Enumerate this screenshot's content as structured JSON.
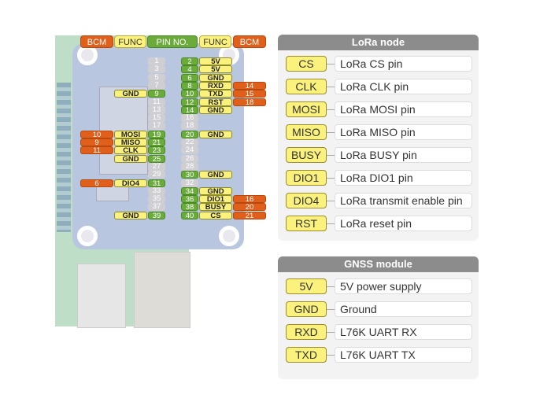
{
  "header": {
    "bcm_left": "BCM",
    "func_left": "FUNC",
    "pin_no": "PIN NO.",
    "func_right": "FUNC",
    "bcm_right": "BCM"
  },
  "pins": {
    "left": [
      {
        "pin": "1",
        "func": "",
        "bcm": "",
        "used": false
      },
      {
        "pin": "3",
        "func": "",
        "bcm": "",
        "used": false
      },
      {
        "pin": "5",
        "func": "",
        "bcm": "",
        "used": false
      },
      {
        "pin": "7",
        "func": "",
        "bcm": "",
        "used": false
      },
      {
        "pin": "9",
        "func": "GND",
        "bcm": "",
        "used": true
      },
      {
        "pin": "11",
        "func": "",
        "bcm": "",
        "used": false
      },
      {
        "pin": "13",
        "func": "",
        "bcm": "",
        "used": false
      },
      {
        "pin": "15",
        "func": "",
        "bcm": "",
        "used": false
      },
      {
        "pin": "17",
        "func": "",
        "bcm": "",
        "used": false
      },
      {
        "pin": "19",
        "func": "MOSI",
        "bcm": "10",
        "used": true
      },
      {
        "pin": "21",
        "func": "MISO",
        "bcm": "9",
        "used": true
      },
      {
        "pin": "23",
        "func": "CLK",
        "bcm": "11",
        "used": true
      },
      {
        "pin": "25",
        "func": "GND",
        "bcm": "",
        "used": true
      },
      {
        "pin": "27",
        "func": "",
        "bcm": "",
        "used": false
      },
      {
        "pin": "29",
        "func": "",
        "bcm": "",
        "used": false
      },
      {
        "pin": "31",
        "func": "DIO4",
        "bcm": "6",
        "used": true
      },
      {
        "pin": "33",
        "func": "",
        "bcm": "",
        "used": false
      },
      {
        "pin": "35",
        "func": "",
        "bcm": "",
        "used": false
      },
      {
        "pin": "37",
        "func": "",
        "bcm": "",
        "used": false
      },
      {
        "pin": "39",
        "func": "GND",
        "bcm": "",
        "used": true
      }
    ],
    "right": [
      {
        "pin": "2",
        "func": "5V",
        "bcm": "",
        "used": true
      },
      {
        "pin": "4",
        "func": "5V",
        "bcm": "",
        "used": true
      },
      {
        "pin": "6",
        "func": "GND",
        "bcm": "",
        "used": true
      },
      {
        "pin": "8",
        "func": "RXD",
        "bcm": "14",
        "used": true
      },
      {
        "pin": "10",
        "func": "TXD",
        "bcm": "15",
        "used": true
      },
      {
        "pin": "12",
        "func": "RST",
        "bcm": "18",
        "used": true
      },
      {
        "pin": "14",
        "func": "GND",
        "bcm": "",
        "used": true
      },
      {
        "pin": "16",
        "func": "",
        "bcm": "",
        "used": false
      },
      {
        "pin": "18",
        "func": "",
        "bcm": "",
        "used": false
      },
      {
        "pin": "20",
        "func": "GND",
        "bcm": "",
        "used": true
      },
      {
        "pin": "22",
        "func": "",
        "bcm": "",
        "used": false
      },
      {
        "pin": "24",
        "func": "",
        "bcm": "",
        "used": false
      },
      {
        "pin": "26",
        "func": "",
        "bcm": "",
        "used": false
      },
      {
        "pin": "28",
        "func": "",
        "bcm": "",
        "used": false
      },
      {
        "pin": "30",
        "func": "GND",
        "bcm": "",
        "used": true
      },
      {
        "pin": "32",
        "func": "",
        "bcm": "",
        "used": false
      },
      {
        "pin": "34",
        "func": "GND",
        "bcm": "",
        "used": true
      },
      {
        "pin": "36",
        "func": "DIO1",
        "bcm": "16",
        "used": true
      },
      {
        "pin": "38",
        "func": "BUSY",
        "bcm": "20",
        "used": true
      },
      {
        "pin": "40",
        "func": "CS",
        "bcm": "21",
        "used": true
      }
    ]
  },
  "lora": {
    "title": "LoRa node",
    "rows": [
      {
        "tag": "CS",
        "desc": "LoRa CS pin"
      },
      {
        "tag": "CLK",
        "desc": "LoRa CLK pin"
      },
      {
        "tag": "MOSI",
        "desc": "LoRa MOSI pin"
      },
      {
        "tag": "MISO",
        "desc": "LoRa MISO pin"
      },
      {
        "tag": "BUSY",
        "desc": "LoRa BUSY pin"
      },
      {
        "tag": "DIO1",
        "desc": "LoRa DIO1 pin"
      },
      {
        "tag": "DIO4",
        "desc": "LoRa transmit enable pin"
      },
      {
        "tag": "RST",
        "desc": "LoRa reset pin"
      }
    ]
  },
  "gnss": {
    "title": "GNSS module",
    "rows": [
      {
        "tag": "5V",
        "desc": "5V power supply"
      },
      {
        "tag": "GND",
        "desc": "Ground"
      },
      {
        "tag": "RXD",
        "desc": "L76K UART RX"
      },
      {
        "tag": "TXD",
        "desc": "L76K UART TX"
      }
    ]
  }
}
